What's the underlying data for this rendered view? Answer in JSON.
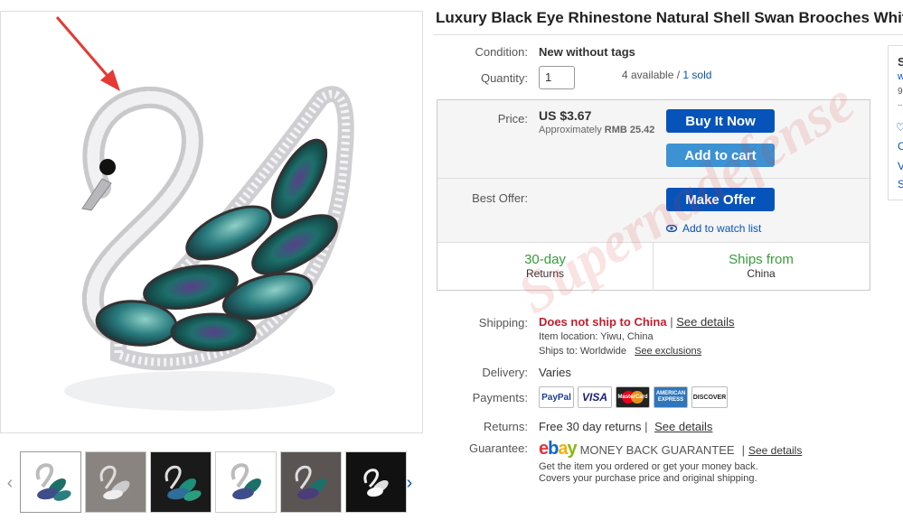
{
  "product": {
    "title": "Luxury Black Eye Rhinestone Natural Shell Swan Brooches White"
  },
  "condition": {
    "label": "Condition:",
    "value": "New without tags"
  },
  "quantity": {
    "label": "Quantity:",
    "value": "1",
    "available": "4 available /",
    "sold": "1 sold"
  },
  "price": {
    "label": "Price:",
    "value": "US $3.67",
    "approx_prefix": "Approximately",
    "approx_value": "RMB 25.42"
  },
  "buttons": {
    "buy": "Buy It Now",
    "cart": "Add to cart",
    "offer": "Make Offer",
    "watch": "Add to watch list"
  },
  "best_offer": {
    "label": "Best Offer:"
  },
  "features": [
    {
      "big": "30-day",
      "small": "Returns"
    },
    {
      "big": "Ships from",
      "small": "China"
    }
  ],
  "shipping": {
    "label": "Shipping:",
    "value": "Does not ship to China",
    "sep": "|",
    "see": "See details",
    "location": "Item location:  Yiwu, China",
    "ships_to": "Ships to:  Worldwide",
    "exclusions": "See exclusions"
  },
  "delivery": {
    "label": "Delivery:",
    "value": "Varies"
  },
  "payments": {
    "label": "Payments:",
    "methods": [
      "PayPal",
      "VISA",
      "MasterCard",
      "AMERICAN EXPRESS",
      "DISCOVER"
    ]
  },
  "returns": {
    "label": "Returns:",
    "value": "Free 30 day returns",
    "sep": "|",
    "see": "See details"
  },
  "guarantee": {
    "label": "Guarantee:",
    "brand": [
      "e",
      "b",
      "a",
      "y"
    ],
    "mbg": "MONEY BACK GUARANTEE",
    "sep": "|",
    "see": "See details",
    "line1": "Get the item you ordered or get your money back.",
    "line2": "Covers your purchase price and original shipping."
  },
  "seller_panel": {
    "letters": [
      "S",
      "w",
      "9",
      "..",
      "C",
      "V",
      "S"
    ]
  },
  "watermark": "Supernadefense",
  "colors": {
    "link": "#0654ba",
    "buy_button": "#0654ba",
    "cart_button": "#3c92d3",
    "feature_green": "#369c3a",
    "alert_red": "#c0202f"
  },
  "icons": {
    "thumb_prev": "chevron-left-icon",
    "thumb_next": "chevron-right-icon",
    "watch": "eye-icon",
    "annotation": "red-arrow"
  }
}
